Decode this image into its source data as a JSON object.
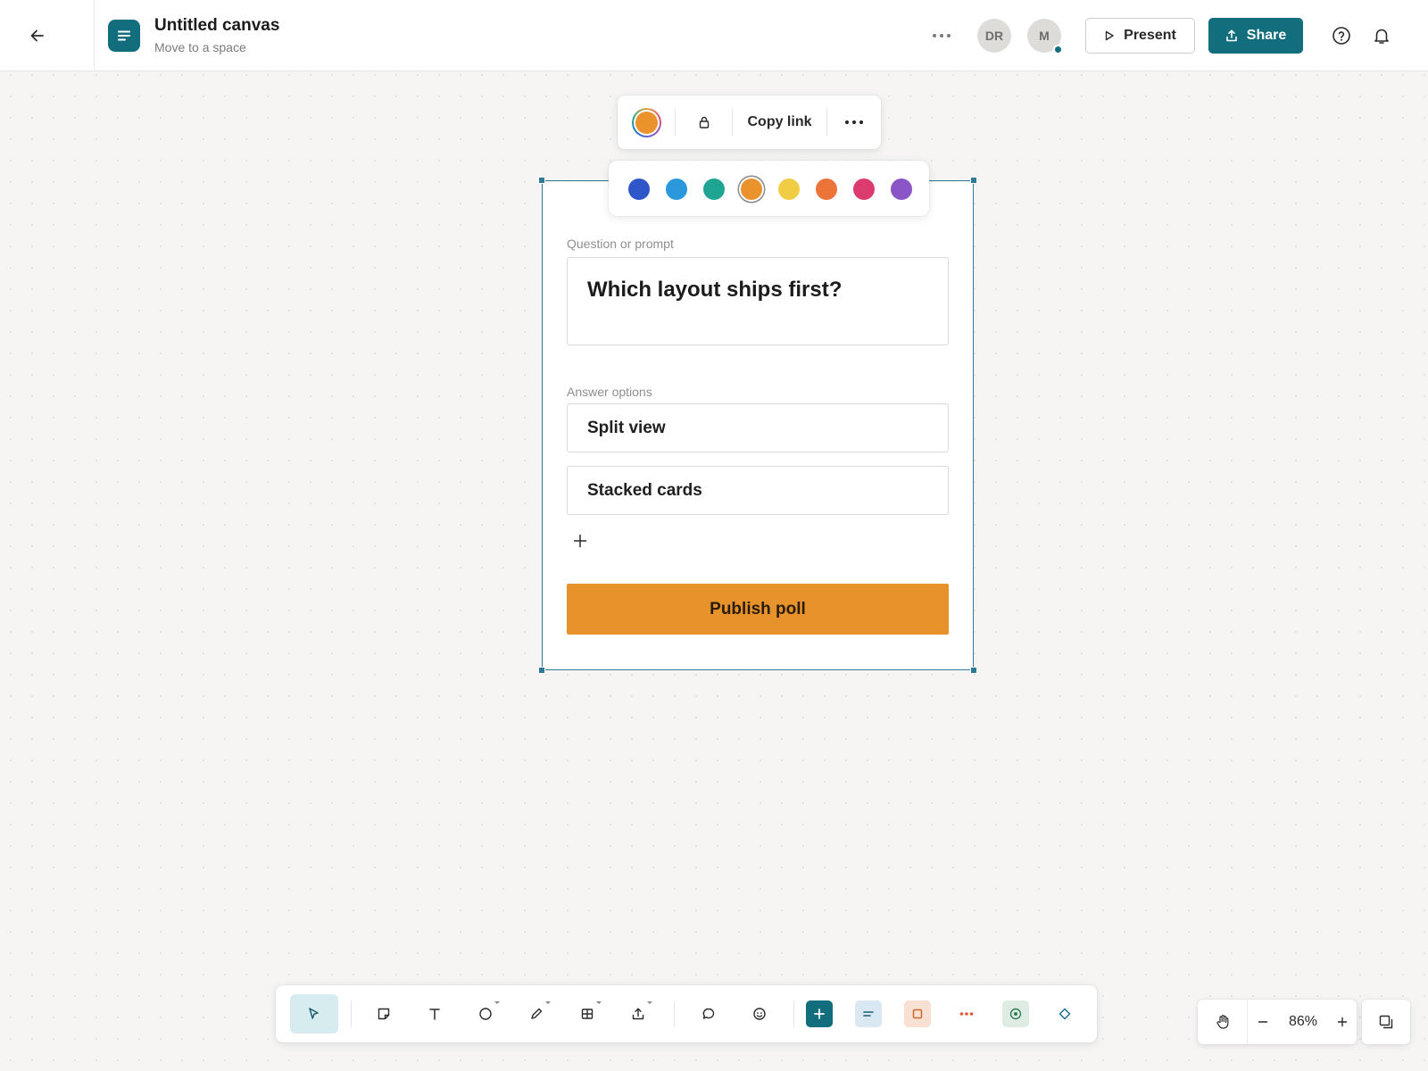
{
  "header": {
    "title": "Untitled canvas",
    "subtitle": "Move to a space",
    "avatars": [
      "DR",
      "M"
    ],
    "present_label": "Present",
    "share_label": "Share"
  },
  "float_toolbar": {
    "copy_link_label": "Copy link",
    "current_color": "#ea922c"
  },
  "palette": {
    "colors": [
      "#2e56c8",
      "#2b98dc",
      "#1fa393",
      "#ea922c",
      "#f1cc45",
      "#ec7438",
      "#dc3b6f",
      "#8a55c6"
    ],
    "selected_index": 3
  },
  "poll": {
    "question_label": "Question or prompt",
    "question": "Which layout ships first?",
    "options_label": "Answer options",
    "options": [
      "Split view",
      "Stacked cards"
    ],
    "publish_label": "Publish poll",
    "accent_color": "#e8922c"
  },
  "bottom_toolbar": {
    "tools": [
      "select-tool",
      "sticky-note-tool",
      "text-tool",
      "shape-tool",
      "pen-tool",
      "table-tool",
      "upload-tool",
      "comment-tool",
      "emoji-tool",
      "add-widget",
      "doc-widget",
      "frame-widget",
      "more-widgets",
      "record-widget",
      "diamond-widget"
    ]
  },
  "zoom": {
    "level": "86%"
  },
  "colors": {
    "brand": "#126e7d",
    "selection": "#2f7a96",
    "canvas": "#f6f5f4"
  }
}
